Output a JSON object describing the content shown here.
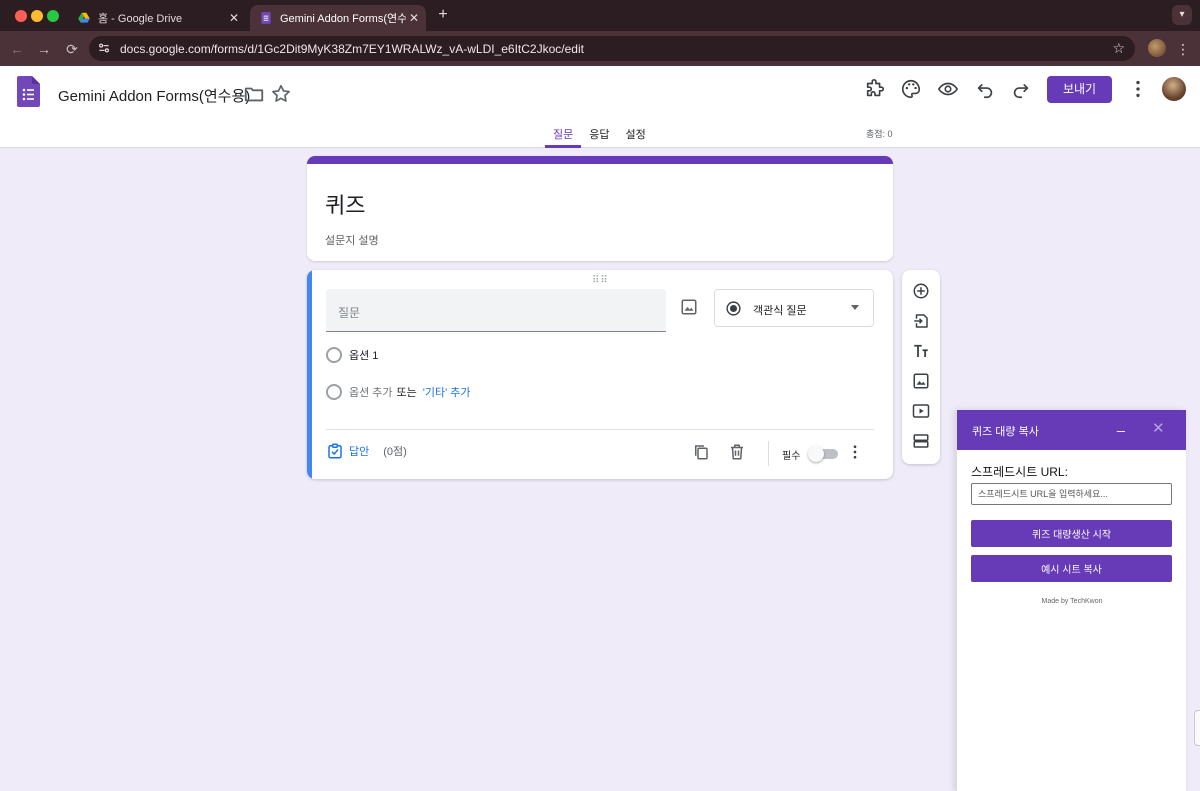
{
  "browser": {
    "tabs": [
      {
        "title": "홈 - Google Drive",
        "close": "✕"
      },
      {
        "title": "Gemini Addon Forms(연수용)",
        "close": "✕"
      }
    ],
    "new_tab": "+",
    "url": "docs.google.com/forms/d/1Gc2Dit9MyK38Zm7EY1WRALWz_vA-wLDI_e6ItC2Jkoc/edit"
  },
  "header": {
    "doc_title": "Gemini Addon Forms(연수용)",
    "send_label": "보내기",
    "tabs": [
      {
        "label": "질문",
        "active": true
      },
      {
        "label": "응답",
        "active": false
      },
      {
        "label": "설정",
        "active": false
      }
    ],
    "total_points": "총점: 0"
  },
  "form": {
    "title": "퀴즈",
    "description": "설문지 설명"
  },
  "question": {
    "placeholder": "질문",
    "type_label": "객관식 질문",
    "option_1": "옵션 1",
    "add_option": "옵션 추가",
    "or": "또는",
    "add_other": "'기타' 추가",
    "answer_key": "답안",
    "points": "(0점)",
    "required": "필수"
  },
  "addon": {
    "title": "퀴즈 대량 복사",
    "minimize": "_",
    "close": "✕",
    "sheet_label": "스프레드시트 URL:",
    "sheet_placeholder": "스프레드시트 URL을 입력하세요...",
    "start_button": "퀴즈 대량생산 시작",
    "example_button": "예시 시트 복사",
    "made_by": "Made by TechKwon"
  },
  "colors": {
    "accent": "#673ab7",
    "background": "#f0ebf8",
    "link": "#1a73e8",
    "question_accent": "#4285f4"
  }
}
